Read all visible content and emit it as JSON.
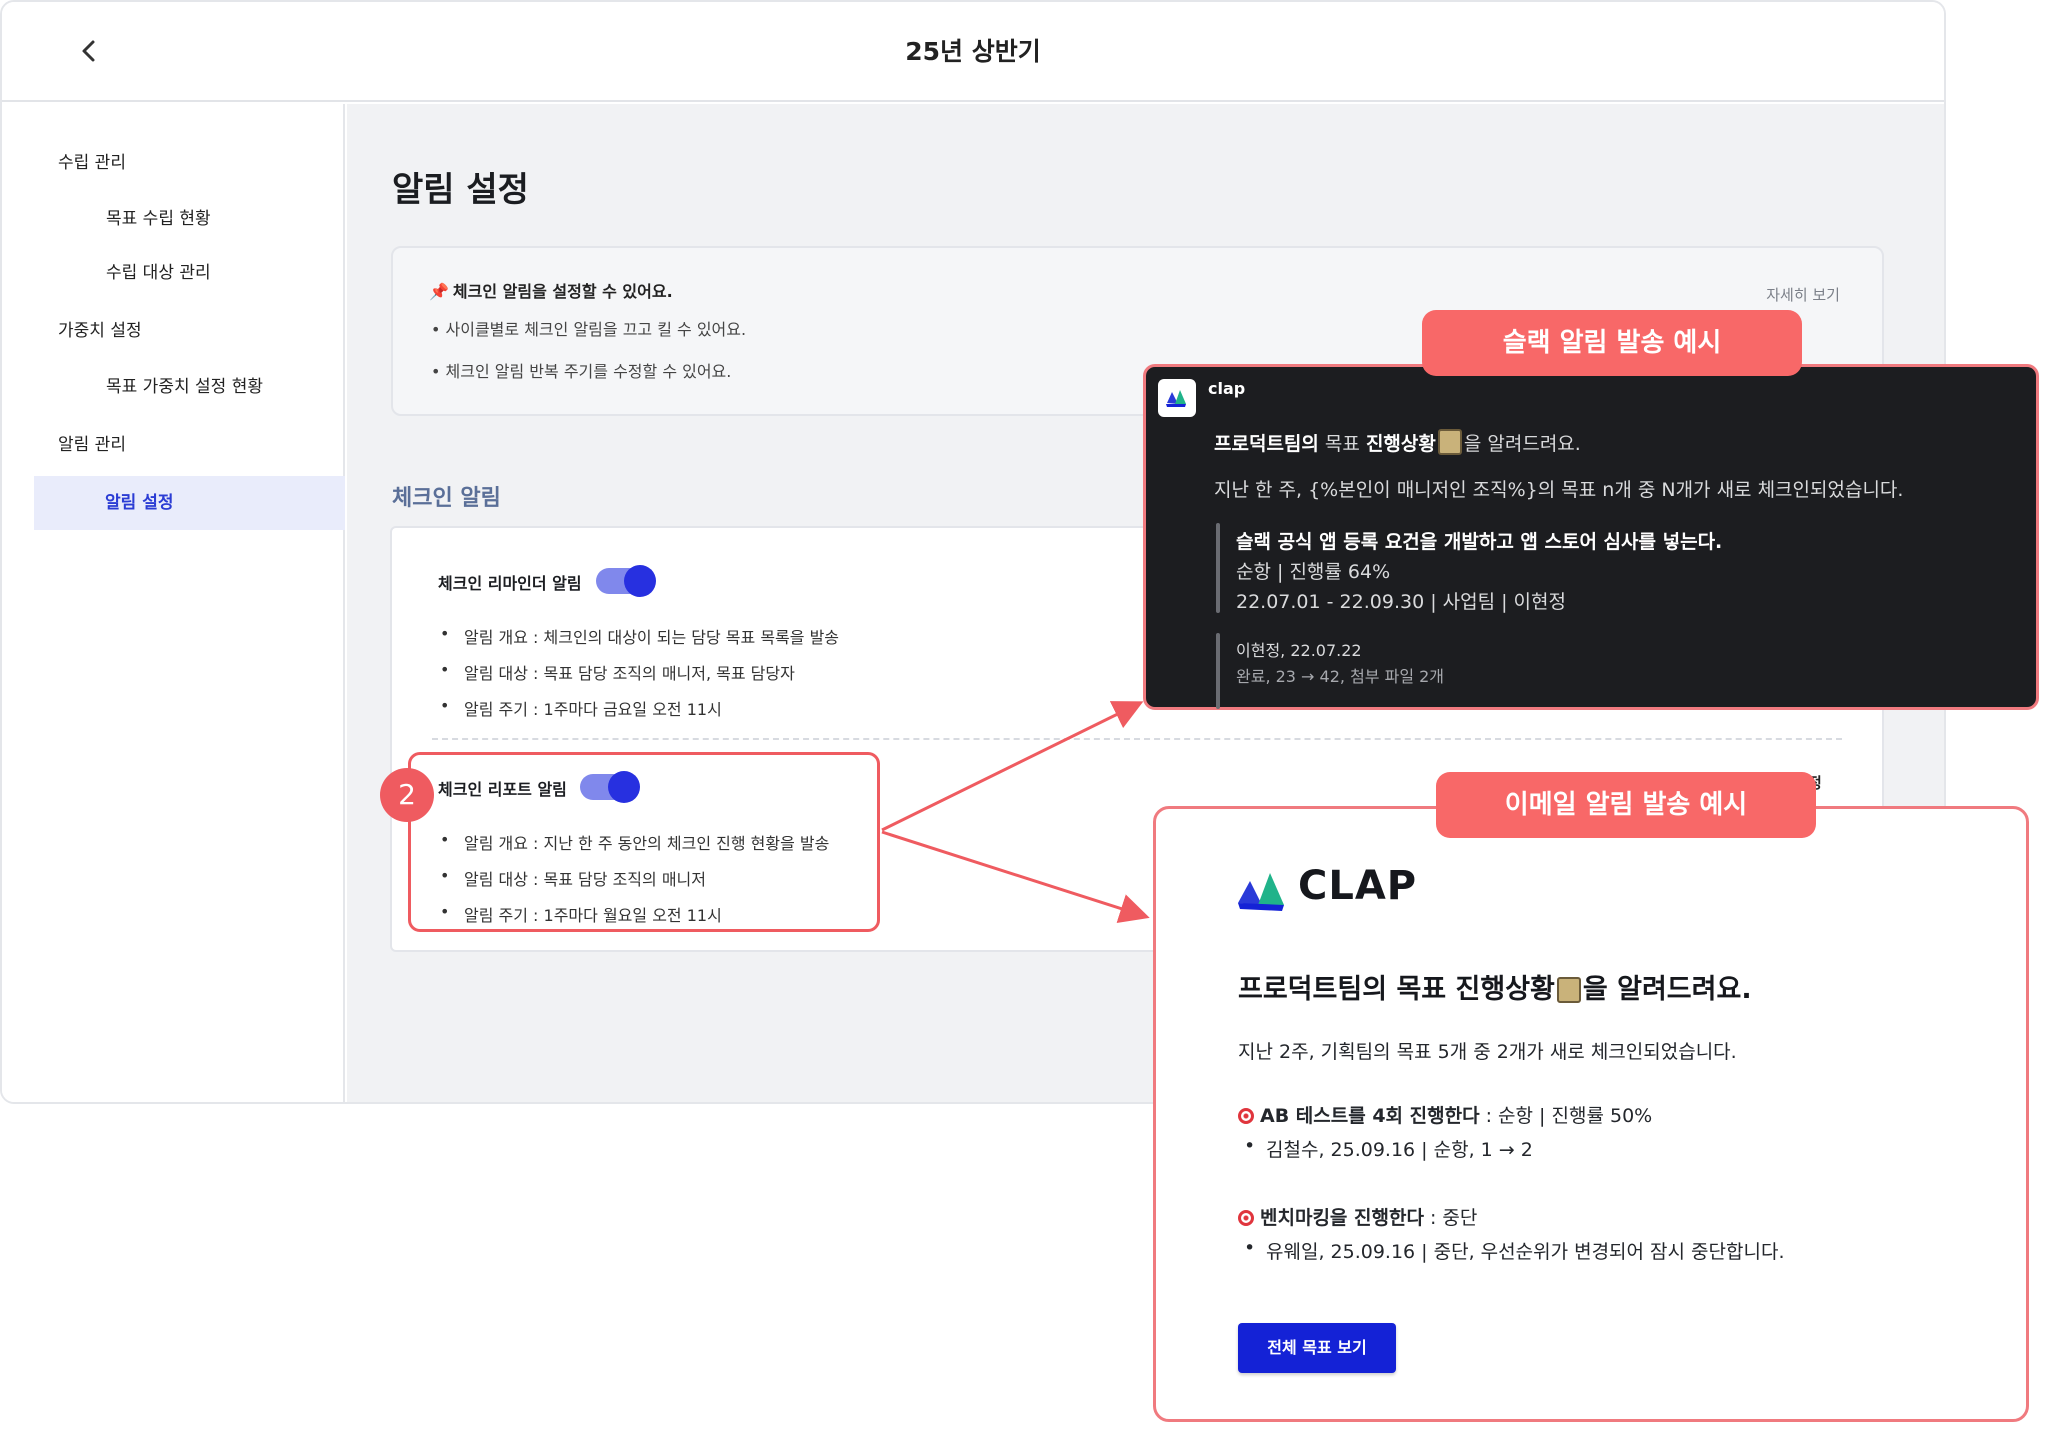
{
  "header": {
    "title": "25년 상반기"
  },
  "sidebar": {
    "groups": [
      {
        "label": "수립 관리"
      },
      {
        "label": "가중치 설정"
      },
      {
        "label": "알림 관리"
      }
    ],
    "items": [
      {
        "label": "목표 수립 현황"
      },
      {
        "label": "수립 대상 관리"
      },
      {
        "label": "목표 가중치 설정 현황"
      },
      {
        "label": "알림 설정"
      }
    ]
  },
  "main": {
    "title": "알림 설정",
    "info": {
      "title": "체크인 알림을 설정할 수 있어요.",
      "bullets": [
        "• 사이클별로 체크인 알림을 끄고 킬 수 있어요.",
        "• 체크인 알림 반복 주기를 수정할 수 있어요."
      ],
      "more_link": "자세히 보기"
    },
    "section_title": "체크인 알림",
    "reminder": {
      "title": "체크인 리마인더 알림",
      "enabled": true,
      "bullets": [
        "알림 개요 : 체크인의 대상이 되는 담당 목표 목록을 발송",
        "알림 대상 : 목표 담당 조직의 매니저, 목표 담당자",
        "알림 주기 : 1주마다 금요일 오전 11시"
      ]
    },
    "report": {
      "step": "2",
      "title": "체크인 리포트 알림",
      "enabled": true,
      "bullets": [
        "알림 개요 : 지난 한 주 동안의 체크인 진행 현황을 발송",
        "알림 대상 : 목표 담당 조직의 매니저",
        "알림 주기 : 1주마다 월요일 오전 11시"
      ],
      "peek_text": "정"
    }
  },
  "slack": {
    "badge": "슬랙 알림 발송 예시",
    "app_name": "clap",
    "headline_bold1": "프로덕트팀의",
    "headline_mid": " 목표 ",
    "headline_bold2": "진행상황",
    "headline_end": "을 알려드려요.",
    "line2": "지난 한 주, {%본인이 매니저인 조직%}의 목표 n개 중 N개가 새로 체크인되었습니다.",
    "goal_title": "슬랙 공식 앱 등록 요건을 개발하고 앱 스토어 심사를 넣는다.",
    "goal_status": "순항 | 진행률 64%",
    "goal_meta": "22.07.01 - 22.09.30 | 사업팀 | 이현정",
    "checkin_author": "이현정, 22.07.22",
    "checkin_detail": "완료, 23 → 42, 첨부 파일 2개"
  },
  "email": {
    "badge": "이메일 알림 발송 예시",
    "logo_text": "CLAP",
    "headline_a": "프로덕트팀의 목표 진행상황",
    "headline_b": "을 알려드려요.",
    "summary": "지난 2주, 기획팀의 목표 5개 중 2개가 새로 체크인되었습니다.",
    "goal1_title": "AB 테스트를 4회 진행한다",
    "goal1_status": " : 순항 | 진행률 50%",
    "goal1_sub": "김철수, 25.09.16 | 순항, 1 → 2",
    "goal2_title": "벤치마킹을 진행한다",
    "goal2_status": " : 중단",
    "goal2_sub": "유웨일, 25.09.16 | 중단, 우선순위가 변경되어 잠시 중단합니다.",
    "button": "전체 목표 보기"
  },
  "colors": {
    "accent": "#2730e0",
    "highlight": "#ef5b60",
    "slack_bg": "#1c1d20",
    "email_button": "#1422d6"
  }
}
